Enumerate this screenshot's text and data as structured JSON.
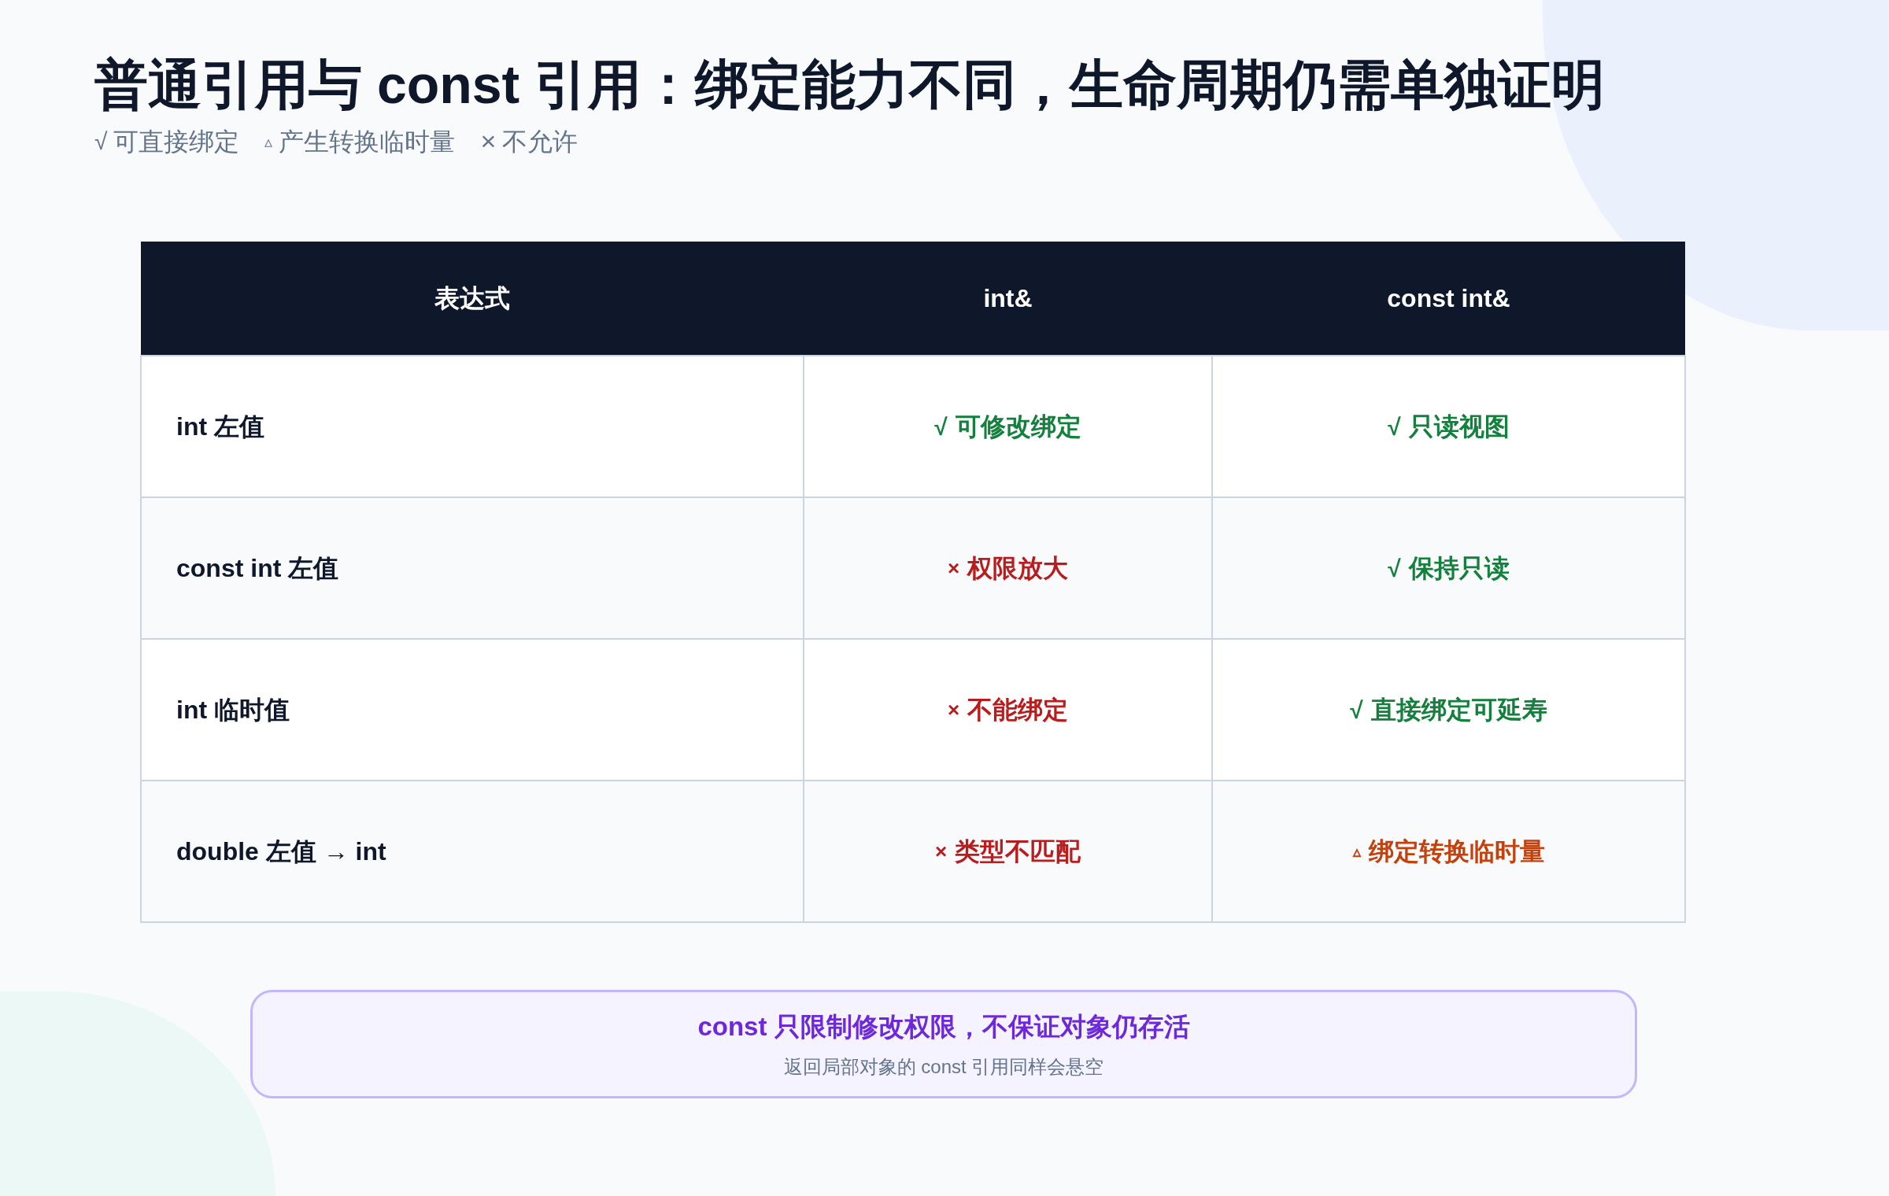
{
  "title": "普通引用与 const 引用：绑定能力不同，生命周期仍需单独证明",
  "legend": [
    {
      "kind": "ok",
      "mark": "√",
      "label": "可直接绑定"
    },
    {
      "kind": "warn",
      "mark": "▵",
      "label": "产生转换临时量"
    },
    {
      "kind": "no",
      "mark": "×",
      "label": "不允许"
    }
  ],
  "table": {
    "columns": [
      "表达式",
      "int&",
      "const int&"
    ],
    "rows": [
      {
        "cells": [
          {
            "kind": "expression",
            "text": "int 左值"
          },
          {
            "kind": "ok",
            "mark": "√",
            "text": "可修改绑定"
          },
          {
            "kind": "ok",
            "mark": "√",
            "text": "只读视图"
          }
        ]
      },
      {
        "cells": [
          {
            "kind": "expression",
            "text": "const int 左值"
          },
          {
            "kind": "no",
            "mark": "×",
            "text": "权限放大"
          },
          {
            "kind": "ok",
            "mark": "√",
            "text": "保持只读"
          }
        ]
      },
      {
        "cells": [
          {
            "kind": "expression",
            "text": "int 临时值"
          },
          {
            "kind": "no",
            "mark": "×",
            "text": "不能绑定"
          },
          {
            "kind": "ok",
            "mark": "√",
            "text": "直接绑定可延寿"
          }
        ]
      },
      {
        "cells": [
          {
            "kind": "expression",
            "text": "double 左值 → int"
          },
          {
            "kind": "no",
            "mark": "×",
            "text": "类型不匹配"
          },
          {
            "kind": "warn",
            "mark": "▵",
            "text": "绑定转换临时量"
          }
        ]
      }
    ]
  },
  "callout": {
    "title": "const 只限制修改权限，不保证对象仍存活",
    "subtitle": "返回局部对象的 const 引用同样会悬空"
  }
}
